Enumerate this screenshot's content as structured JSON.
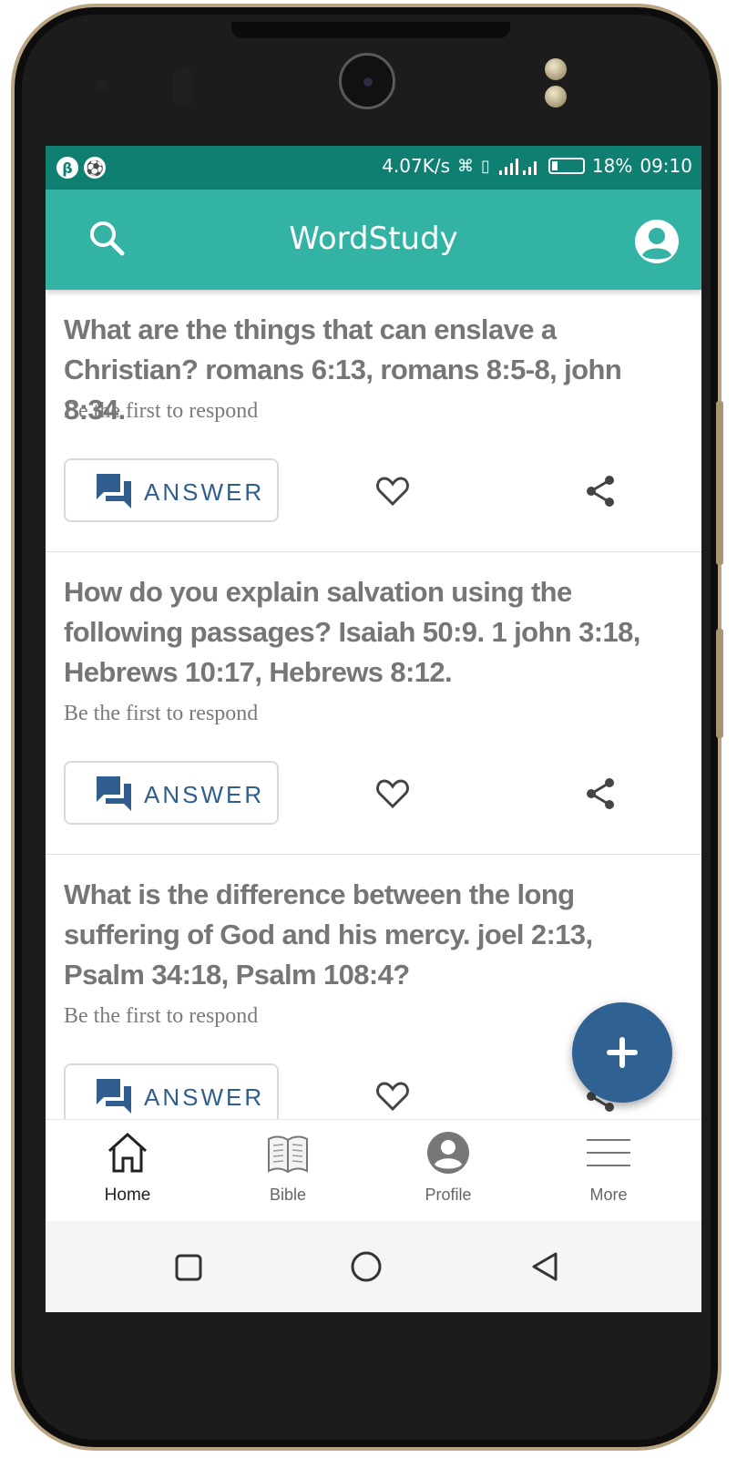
{
  "status_bar": {
    "speed": "4.07K/s",
    "battery": "18%",
    "time": "09:10"
  },
  "appbar": {
    "title": "WordStudy",
    "search_icon": "search-icon",
    "account_icon": "account-circle-icon"
  },
  "posts": [
    {
      "question": "What are the things that can enslave a Christian? romans 6:13, romans 8:5-8, john 8:34.",
      "status": "Be the first to respond",
      "answer_label": "ANSWER"
    },
    {
      "question": "How do you explain salvation using the following passages?  Isaiah 50:9. 1 john 3:18, Hebrews 10:17, Hebrews 8:12.",
      "status": "Be the first to respond",
      "answer_label": "ANSWER"
    },
    {
      "question": "What is the difference between the long suffering of God and his mercy.  joel 2:13, Psalm 34:18, Psalm 108:4?",
      "status": "Be the first to respond",
      "answer_label": "ANSWER"
    }
  ],
  "bottom_nav": [
    {
      "label": "Home",
      "icon": "home-icon",
      "active": true
    },
    {
      "label": "Bible",
      "icon": "book-icon",
      "active": false
    },
    {
      "label": "Profile",
      "icon": "profile-icon",
      "active": false
    },
    {
      "label": "More",
      "icon": "menu-icon",
      "active": false
    }
  ],
  "colors": {
    "status_bar": "#0e7f71",
    "appbar": "#33b3a3",
    "accent": "#2f6193",
    "text_gray": "#767676"
  }
}
